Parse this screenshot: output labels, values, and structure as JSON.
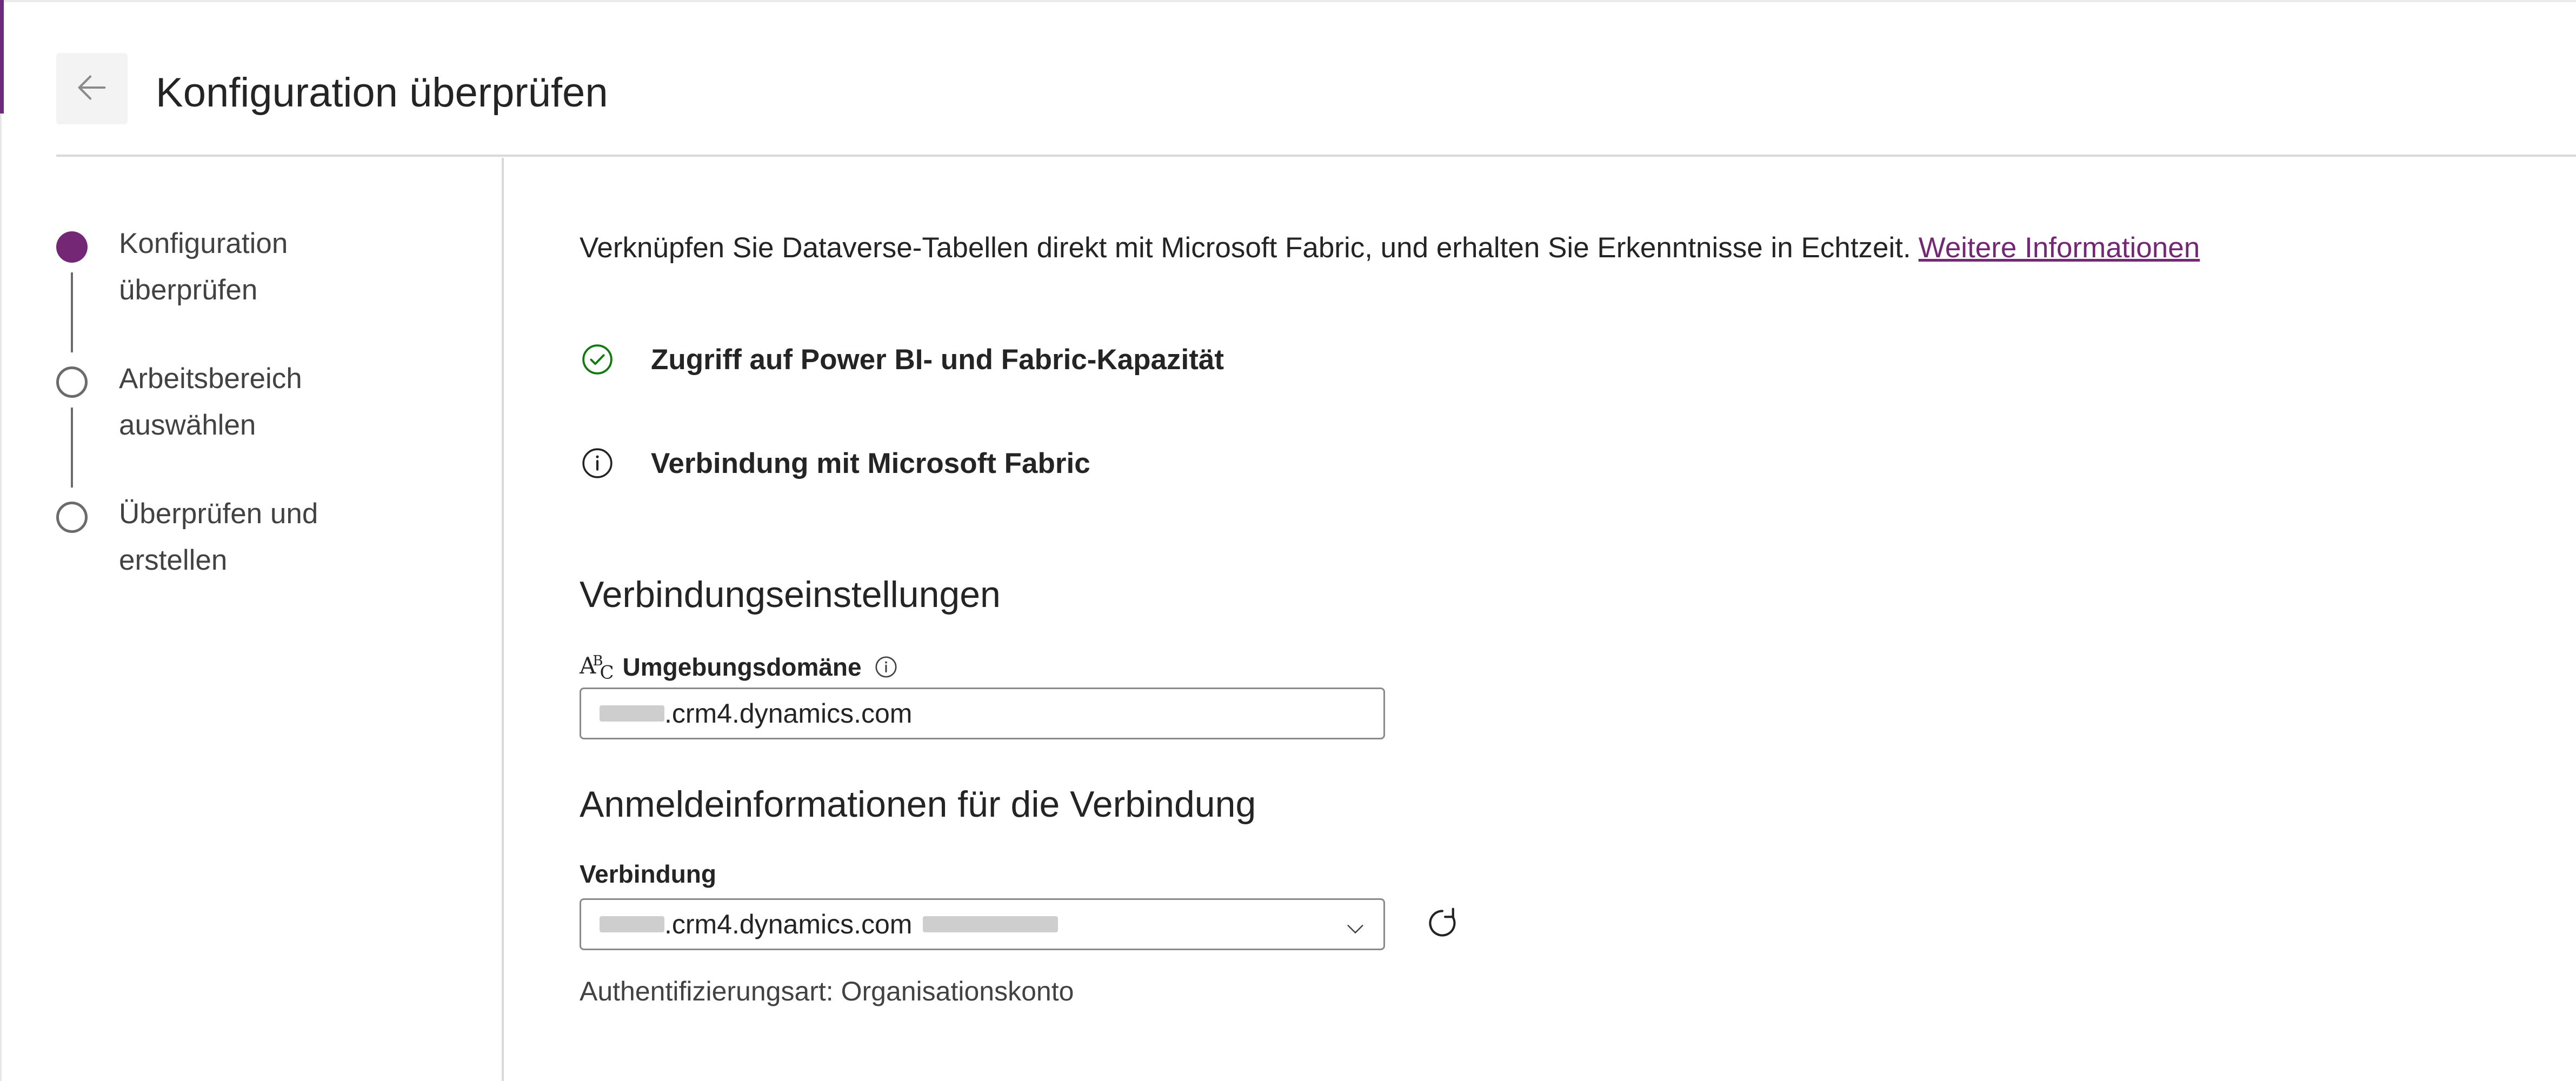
{
  "header": {
    "title": "Konfiguration überprüfen",
    "back_icon": "arrow-left-icon"
  },
  "stepper": {
    "steps": [
      {
        "label_line1": "Konfiguration",
        "label_line2": "überprüfen",
        "state": "active"
      },
      {
        "label_line1": "Arbeitsbereich",
        "label_line2": "auswählen",
        "state": "inactive"
      },
      {
        "label_line1": "Überprüfen und",
        "label_line2": "erstellen",
        "state": "inactive"
      }
    ]
  },
  "main": {
    "intro_text": "Verknüpfen Sie Dataverse-Tabellen direkt mit Microsoft Fabric, und erhalten Sie Erkenntnisse in Echtzeit.",
    "intro_link": "Weitere Informationen",
    "checks": [
      {
        "label": "Zugriff auf Power BI- und Fabric-Kapazität",
        "icon": "check-circle-icon",
        "status": "success"
      },
      {
        "label": "Verbindung mit Microsoft Fabric",
        "icon": "info-circle-icon",
        "status": "info"
      }
    ],
    "connection_settings": {
      "title": "Verbindungseinstellungen",
      "env_domain_label": "Umgebungsdomäne",
      "env_domain_value": ".crm4.dynamics.com"
    },
    "credentials": {
      "title": "Anmeldeinformationen für die Verbindung",
      "connection_label": "Verbindung",
      "connection_value": ".crm4.dynamics.com",
      "auth_type": "Authentifizierungsart: Organisationskonto"
    }
  },
  "colors": {
    "accent": "#742774",
    "success": "#107c10",
    "link": "#742774",
    "border": "#8a8a8a"
  }
}
